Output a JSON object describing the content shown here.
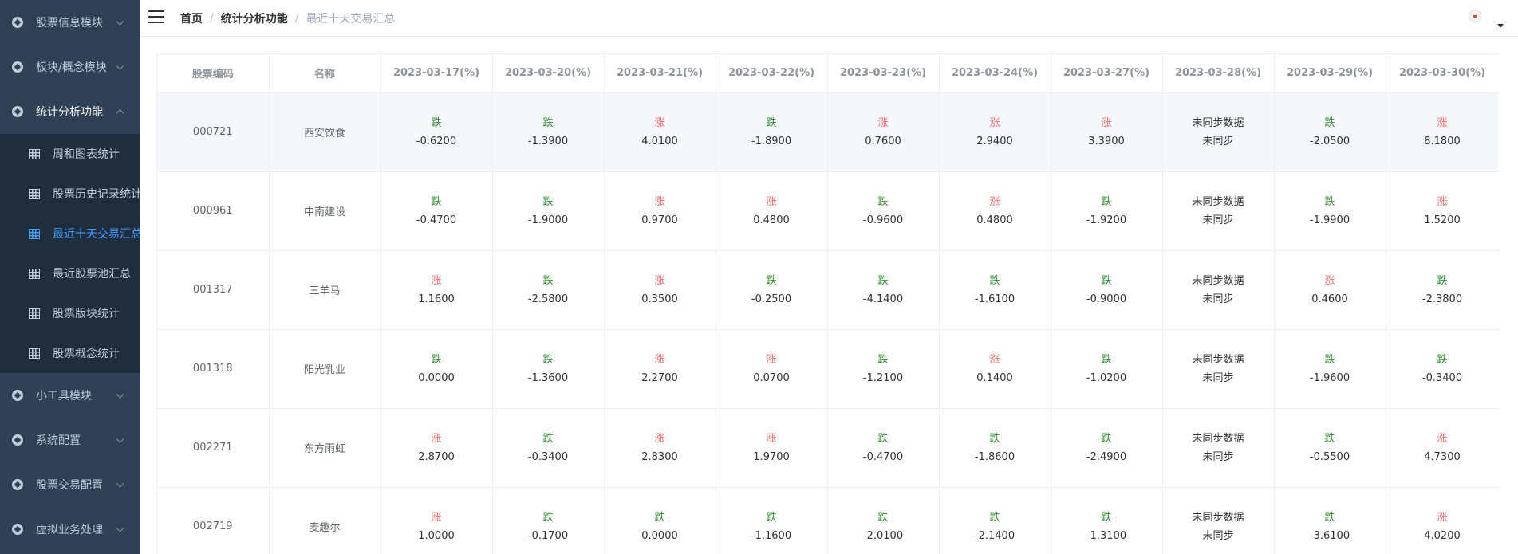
{
  "sidebar": {
    "top_items": [
      {
        "label": "股票信息模块"
      },
      {
        "label": "板块/概念模块"
      },
      {
        "label": "统计分析功能"
      },
      {
        "label": "小工具模块"
      },
      {
        "label": "系统配置"
      },
      {
        "label": "股票交易配置"
      },
      {
        "label": "虚拟业务处理"
      }
    ],
    "sub_items": [
      {
        "label": "周和图表统计"
      },
      {
        "label": "股票历史记录统计"
      },
      {
        "label": "最近十天交易汇总"
      },
      {
        "label": "最近股票池汇总"
      },
      {
        "label": "股票版块统计"
      },
      {
        "label": "股票概念统计"
      }
    ]
  },
  "breadcrumb": {
    "home": "首页",
    "parent": "统计分析功能",
    "current": "最近十天交易汇总"
  },
  "table": {
    "headers": [
      "股票编码",
      "名称",
      "2023-03-17(%)",
      "2023-03-20(%)",
      "2023-03-21(%)",
      "2023-03-22(%)",
      "2023-03-23(%)",
      "2023-03-24(%)",
      "2023-03-27(%)",
      "2023-03-28(%)",
      "2023-03-29(%)",
      "2023-03-30(%)"
    ],
    "rows": [
      {
        "code": "000721",
        "name": "西安饮食",
        "cells": [
          {
            "dir": "跌",
            "val": "-0.6200"
          },
          {
            "dir": "跌",
            "val": "-1.3900"
          },
          {
            "dir": "涨",
            "val": "4.0100"
          },
          {
            "dir": "跌",
            "val": "-1.8900"
          },
          {
            "dir": "涨",
            "val": "0.7600"
          },
          {
            "dir": "涨",
            "val": "2.9400"
          },
          {
            "dir": "涨",
            "val": "3.3900"
          },
          {
            "dir": "未同步数据",
            "val": "未同步"
          },
          {
            "dir": "跌",
            "val": "-2.0500"
          },
          {
            "dir": "涨",
            "val": "8.1800"
          }
        ]
      },
      {
        "code": "000961",
        "name": "中南建设",
        "cells": [
          {
            "dir": "跌",
            "val": "-0.4700"
          },
          {
            "dir": "跌",
            "val": "-1.9000"
          },
          {
            "dir": "涨",
            "val": "0.9700"
          },
          {
            "dir": "涨",
            "val": "0.4800"
          },
          {
            "dir": "跌",
            "val": "-0.9600"
          },
          {
            "dir": "涨",
            "val": "0.4800"
          },
          {
            "dir": "跌",
            "val": "-1.9200"
          },
          {
            "dir": "未同步数据",
            "val": "未同步"
          },
          {
            "dir": "跌",
            "val": "-1.9900"
          },
          {
            "dir": "涨",
            "val": "1.5200"
          }
        ]
      },
      {
        "code": "001317",
        "name": "三羊马",
        "cells": [
          {
            "dir": "涨",
            "val": "1.1600"
          },
          {
            "dir": "跌",
            "val": "-2.5800"
          },
          {
            "dir": "涨",
            "val": "0.3500"
          },
          {
            "dir": "跌",
            "val": "-0.2500"
          },
          {
            "dir": "跌",
            "val": "-4.1400"
          },
          {
            "dir": "跌",
            "val": "-1.6100"
          },
          {
            "dir": "跌",
            "val": "-0.9000"
          },
          {
            "dir": "未同步数据",
            "val": "未同步"
          },
          {
            "dir": "涨",
            "val": "0.4600"
          },
          {
            "dir": "跌",
            "val": "-2.3800"
          }
        ]
      },
      {
        "code": "001318",
        "name": "阳光乳业",
        "cells": [
          {
            "dir": "跌",
            "val": "0.0000"
          },
          {
            "dir": "跌",
            "val": "-1.3600"
          },
          {
            "dir": "涨",
            "val": "2.2700"
          },
          {
            "dir": "涨",
            "val": "0.0700"
          },
          {
            "dir": "跌",
            "val": "-1.2100"
          },
          {
            "dir": "涨",
            "val": "0.1400"
          },
          {
            "dir": "跌",
            "val": "-1.0200"
          },
          {
            "dir": "未同步数据",
            "val": "未同步"
          },
          {
            "dir": "跌",
            "val": "-1.9600"
          },
          {
            "dir": "跌",
            "val": "-0.3400"
          }
        ]
      },
      {
        "code": "002271",
        "name": "东方雨虹",
        "cells": [
          {
            "dir": "涨",
            "val": "2.8700"
          },
          {
            "dir": "跌",
            "val": "-0.3400"
          },
          {
            "dir": "涨",
            "val": "2.8300"
          },
          {
            "dir": "涨",
            "val": "1.9700"
          },
          {
            "dir": "跌",
            "val": "-0.4700"
          },
          {
            "dir": "跌",
            "val": "-1.8600"
          },
          {
            "dir": "跌",
            "val": "-2.4900"
          },
          {
            "dir": "未同步数据",
            "val": "未同步"
          },
          {
            "dir": "跌",
            "val": "-0.5500"
          },
          {
            "dir": "涨",
            "val": "4.7300"
          }
        ]
      },
      {
        "code": "002719",
        "name": "麦趣尔",
        "cells": [
          {
            "dir": "涨",
            "val": "1.0000"
          },
          {
            "dir": "跌",
            "val": "-0.1700"
          },
          {
            "dir": "跌",
            "val": "0.0000"
          },
          {
            "dir": "跌",
            "val": "-1.1600"
          },
          {
            "dir": "跌",
            "val": "-2.0100"
          },
          {
            "dir": "跌",
            "val": "-2.1400"
          },
          {
            "dir": "跌",
            "val": "-1.3100"
          },
          {
            "dir": "未同步数据",
            "val": "未同步"
          },
          {
            "dir": "跌",
            "val": "-3.6100"
          },
          {
            "dir": "涨",
            "val": "4.0200"
          }
        ]
      }
    ]
  },
  "colors": {
    "up": "#f56c6c",
    "down": "#2e8b2e",
    "unsynced": "#303133",
    "sidebar_bg": "#304156",
    "submenu_bg": "#1f2d3d",
    "active": "#409eff"
  },
  "icons": {
    "menu": "circle-gear-icon",
    "sub": "grid-table-icon",
    "toggle": "hamburger-icon",
    "user": "avatar-icon"
  }
}
